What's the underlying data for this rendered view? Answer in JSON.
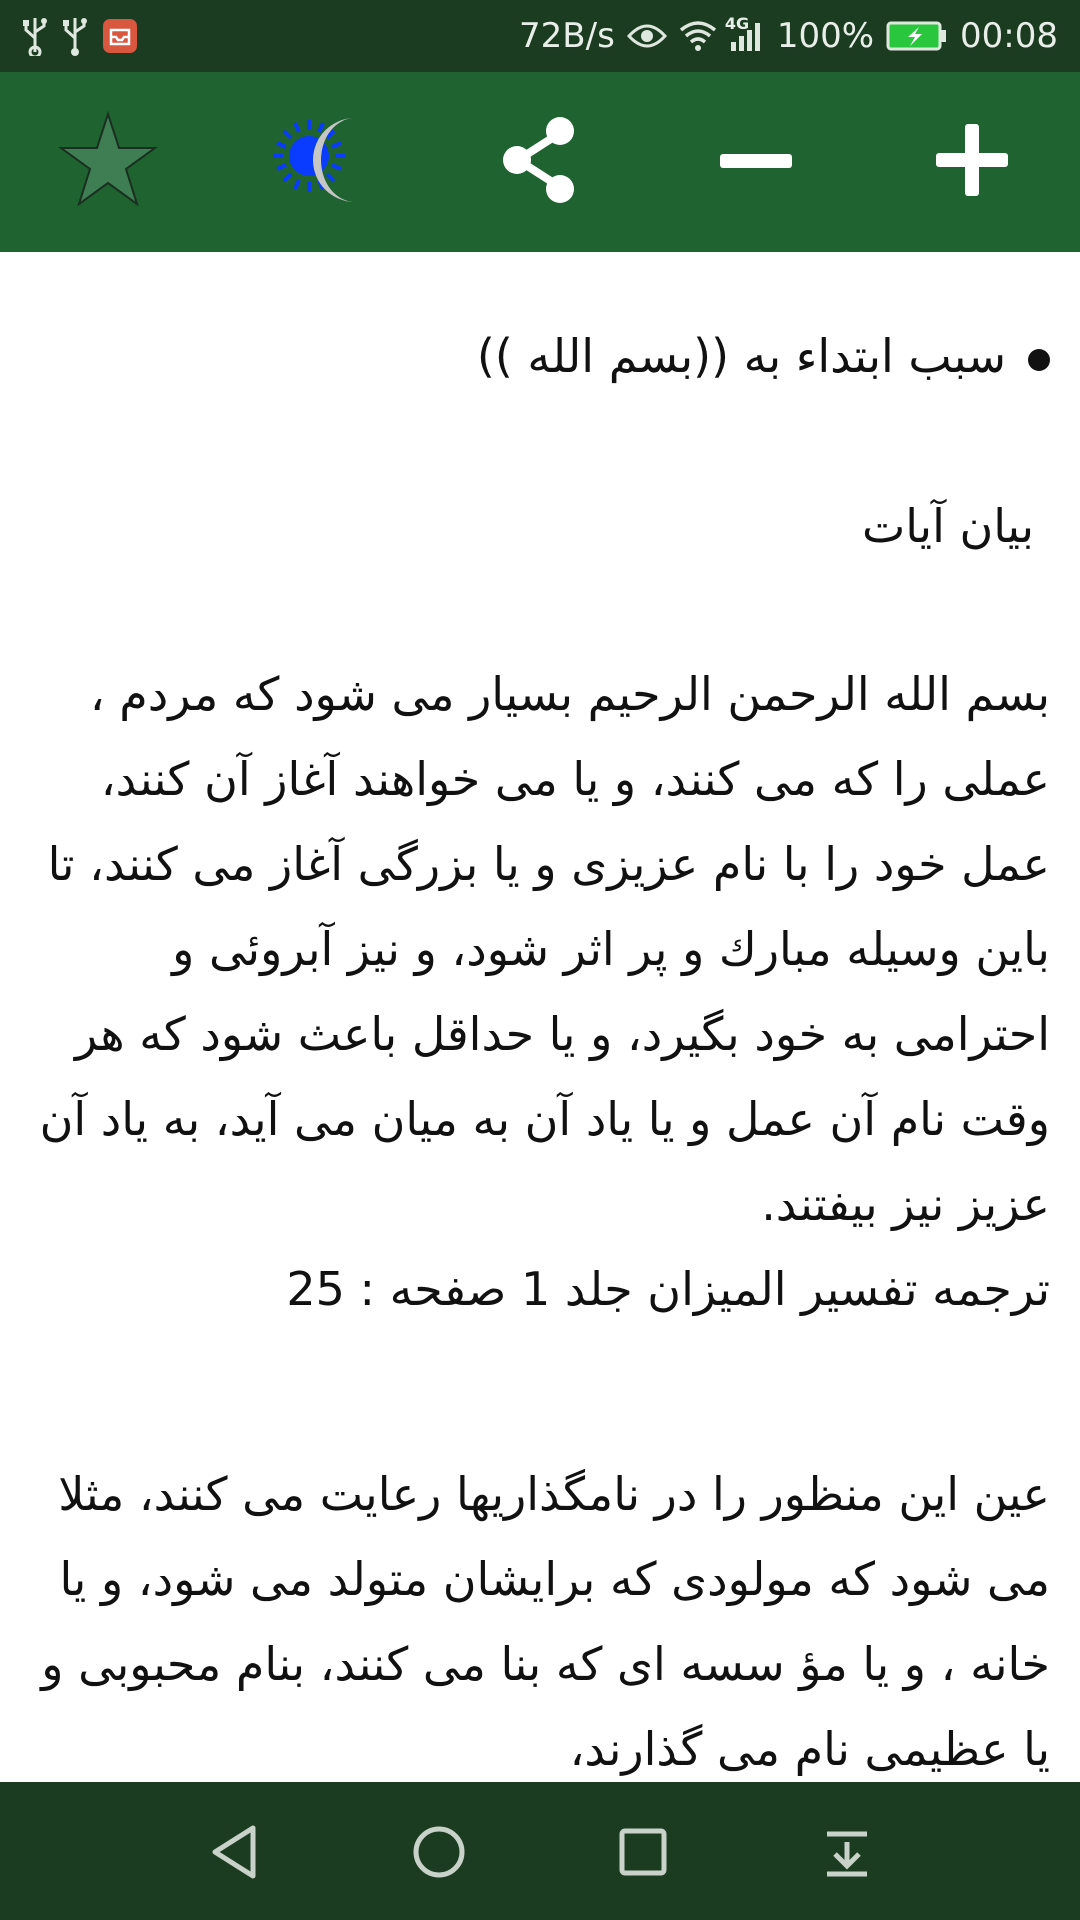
{
  "status_bar": {
    "net_speed": "72B/s",
    "network_type": "4G",
    "battery_percent": "100%",
    "time": "00:08",
    "icons_left": [
      "usb-icon",
      "usb-icon",
      "store-icon"
    ],
    "icons_right": [
      "eye-icon",
      "wifi-icon",
      "signal-icon",
      "battery-icon"
    ]
  },
  "toolbar": {
    "buttons": [
      "star-icon",
      "day-night-icon",
      "share-icon",
      "zoom-out-icon",
      "zoom-in-icon"
    ],
    "colors": {
      "background": "#1e6330",
      "sun": "#0a3cff",
      "moon": "#c0c0c0",
      "star": "#3f7d52"
    }
  },
  "content": {
    "heading": "سبب ابتداء به ((بسم الله ))",
    "subheading": "بیان آیات",
    "paragraph1": "بسم الله الرحمن الرحیم بسیار می شود که مردم ، عملی را که می کنند، و یا می خواهند آغاز آن کنند، عمل خود را با نام عزیزی و یا بزرگی آغاز می کنند، تا باین وسیله مبارك و پر اثر شود، و نیز آبروئی و احترامی به خود بگیرد، و یا حداقل باعث شود که هر وقت نام آن عمل و یا یاد آن به میان می آید، به یاد آن عزیز نیز بیفتند.",
    "citation": "ترجمه تفسیر المیزان جلد 1 صفحه : 25",
    "paragraph2": "عین این منظور را در نامگذاریها رعایت می کنند، مثلا می شود که مولودی که برایشان متولد می شود، و یا خانه ، و یا مؤ سسه ای که بنا می کنند، بنام محبوبی و یا عظیمی نام می گذارند،"
  },
  "nav_bar": {
    "buttons": [
      "back-icon",
      "home-icon",
      "recents-icon",
      "notification-drawer-icon"
    ]
  }
}
